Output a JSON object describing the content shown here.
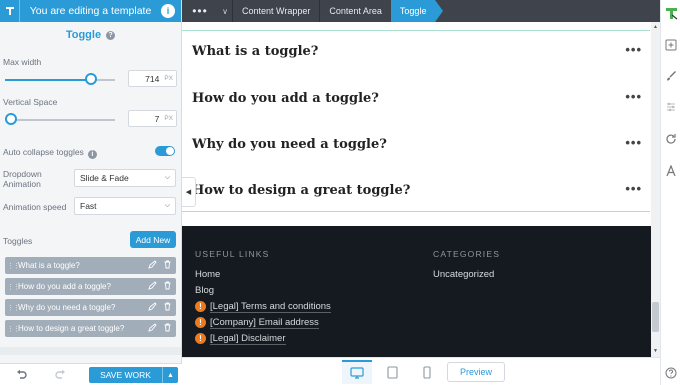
{
  "header": {
    "title": "You are editing a template"
  },
  "panel": {
    "title": "Toggle",
    "max_width": {
      "label": "Max width",
      "value": "714",
      "unit": "PX",
      "fraction": 0.82
    },
    "vertical_space": {
      "label": "Vertical Space",
      "value": "7",
      "unit": "PX",
      "fraction": 0.0
    },
    "auto_collapse": {
      "label": "Auto collapse toggles",
      "on": true
    },
    "dropdown_animation": {
      "label": "Dropdown Animation",
      "value": "Slide & Fade"
    },
    "animation_speed": {
      "label": "Animation speed",
      "value": "Fast"
    },
    "toggles_label": "Toggles",
    "add_new_label": "Add New",
    "toggle_items": [
      "What is a toggle?",
      "How do you add a toggle?",
      "Why do you need a toggle?",
      "How to design a great toggle?"
    ]
  },
  "footer_bar": {
    "save_label": "SAVE WORK"
  },
  "breadcrumb": {
    "items": [
      "Content Wrapper",
      "Content Area",
      "Toggle"
    ]
  },
  "canvas": {
    "toggles": [
      "What is a toggle?",
      "How do you add a toggle?",
      "Why do you need a toggle?",
      "How to design a great toggle?"
    ],
    "site_footer": {
      "useful_links_heading": "USEFUL LINKS",
      "links": [
        "Home",
        "Blog"
      ],
      "warn_links": [
        "[Legal] Terms and conditions",
        "[Company] Email address",
        "[Legal] Disclaimer"
      ],
      "categories_heading": "CATEGORIES",
      "categories": [
        "Uncategorized"
      ]
    }
  },
  "devices": {
    "preview_label": "Preview"
  },
  "colors": {
    "accent": "#2b9bd8",
    "topbar": "#3f444c",
    "footer_bg": "#141a1f",
    "warning": "#f07a1a"
  }
}
